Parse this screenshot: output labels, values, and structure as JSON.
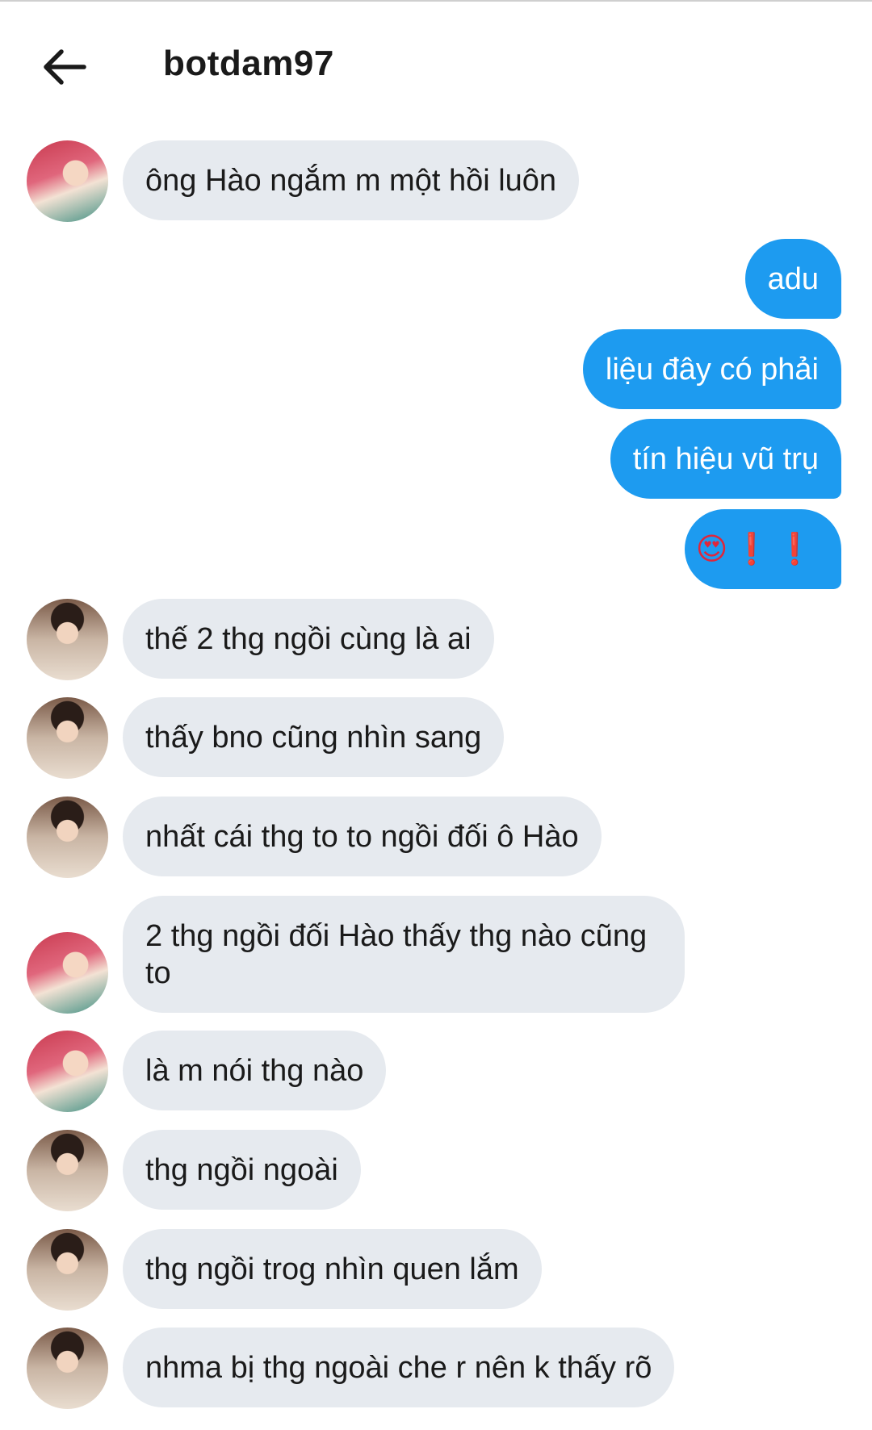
{
  "header": {
    "title": "botdam97"
  },
  "messages": [
    {
      "from": "them",
      "avatar": "a",
      "text": "ông Hào ngắm m một hồi luôn"
    },
    {
      "from": "me",
      "text": "adu"
    },
    {
      "from": "me",
      "text": "liệu đây có phải"
    },
    {
      "from": "me",
      "text": "tín hiệu vũ trụ"
    },
    {
      "from": "me",
      "text": "😍❗❗"
    },
    {
      "from": "them",
      "avatar": "b",
      "text": "thế 2 thg ngồi cùng là ai"
    },
    {
      "from": "them",
      "avatar": "b",
      "text": "thấy bno cũng nhìn sang"
    },
    {
      "from": "them",
      "avatar": "b",
      "text": "nhất cái thg to to ngồi đối ô Hào"
    },
    {
      "from": "them",
      "avatar": "a",
      "text": "2 thg ngồi đối Hào thấy thg nào cũng to"
    },
    {
      "from": "them",
      "avatar": "a",
      "text": "là m nói thg nào"
    },
    {
      "from": "them",
      "avatar": "b",
      "text": "thg ngồi ngoài"
    },
    {
      "from": "them",
      "avatar": "b",
      "text": "thg ngồi trog nhìn quen lắm"
    },
    {
      "from": "them",
      "avatar": "b",
      "text": "nhma bị thg ngoài che r nên k thấy rõ"
    }
  ],
  "colors": {
    "outgoing": "#1d9bf0",
    "incoming": "#e6eaef"
  },
  "icons": {
    "back": "arrow-left-icon"
  }
}
